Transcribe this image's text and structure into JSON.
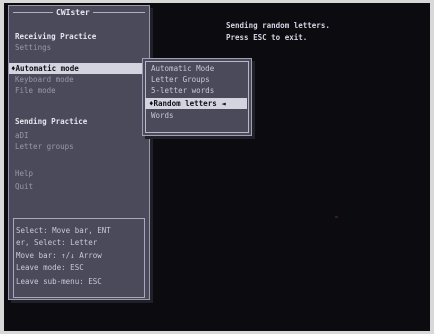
{
  "main_menu": {
    "title": "CWIster",
    "items": [
      {
        "label": "Receiving Practice",
        "state": "heading"
      },
      {
        "label": "Settings",
        "state": "dim"
      },
      {
        "label": "♦Automatic mode",
        "state": "selected"
      },
      {
        "label": "Keyboard mode",
        "state": "dim"
      },
      {
        "label": "File mode",
        "state": "dim"
      },
      {
        "label": "Sending Practice",
        "state": "heading"
      },
      {
        "label": "aDI",
        "state": "dim"
      },
      {
        "label": "Letter groups",
        "state": "dim"
      },
      {
        "label": "Help",
        "state": "dim"
      },
      {
        "label": "Quit",
        "state": "dim"
      }
    ],
    "help_lines": [
      "Select: Move bar, ENT",
      "er, Select: Letter",
      "Move bar: ↑/↓ Arrow",
      "Leave mode: ESC",
      "Leave sub-menu: ESC"
    ]
  },
  "submenu": {
    "items": [
      {
        "label": "Automatic Mode",
        "state": "normal"
      },
      {
        "label": "Letter Groups",
        "state": "normal"
      },
      {
        "label": "5-letter words",
        "state": "normal"
      },
      {
        "label": "♦Random letters ◄",
        "state": "selected"
      },
      {
        "label": "Words",
        "state": "normal"
      }
    ]
  },
  "status": {
    "line1": "Sending random letters.",
    "line2": "Press ESC to exit."
  }
}
